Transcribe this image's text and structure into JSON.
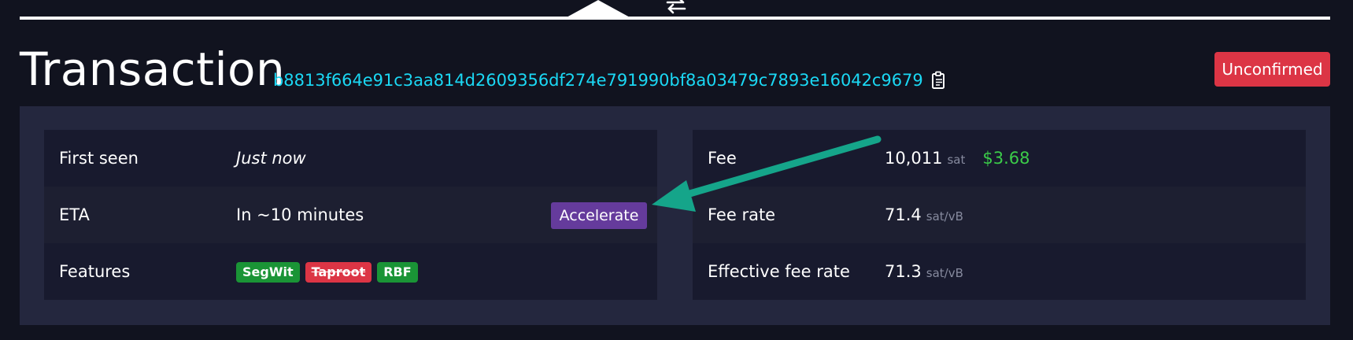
{
  "header": {
    "title": "Transaction",
    "txid": "b8813f664e91c3aa814d2609356df274e791990bf8a03479c7893e16042c9679",
    "status": "Unconfirmed"
  },
  "details_left": [
    {
      "label": "First seen",
      "value": "Just now"
    },
    {
      "label": "ETA",
      "value": "In ~10 minutes",
      "action": "Accelerate"
    },
    {
      "label": "Features",
      "badges": [
        "SegWit",
        "Taproot",
        "RBF"
      ]
    }
  ],
  "details_right": [
    {
      "label": "Fee",
      "value": "10,011",
      "unit": "sat",
      "fiat": "$3.68"
    },
    {
      "label": "Fee rate",
      "value": "71.4",
      "unit": "sat/vB"
    },
    {
      "label": "Effective fee rate",
      "value": "71.3",
      "unit": "sat/vB"
    }
  ],
  "colors": {
    "background": "#11131f",
    "panel": "#24273e",
    "txid_link": "#1bd8f4",
    "unconfirmed_badge": "#dc3545",
    "accelerate_button": "#653b9c",
    "feature_supported": "#1a9436",
    "feature_unsupported": "#dc3545",
    "fiat_value": "#3bcc49",
    "annotation_arrow": "#15a58a"
  },
  "icons": {
    "swap": "swap-arrows-icon",
    "copy": "clipboard-icon",
    "annotation": "arrow-annotation"
  }
}
